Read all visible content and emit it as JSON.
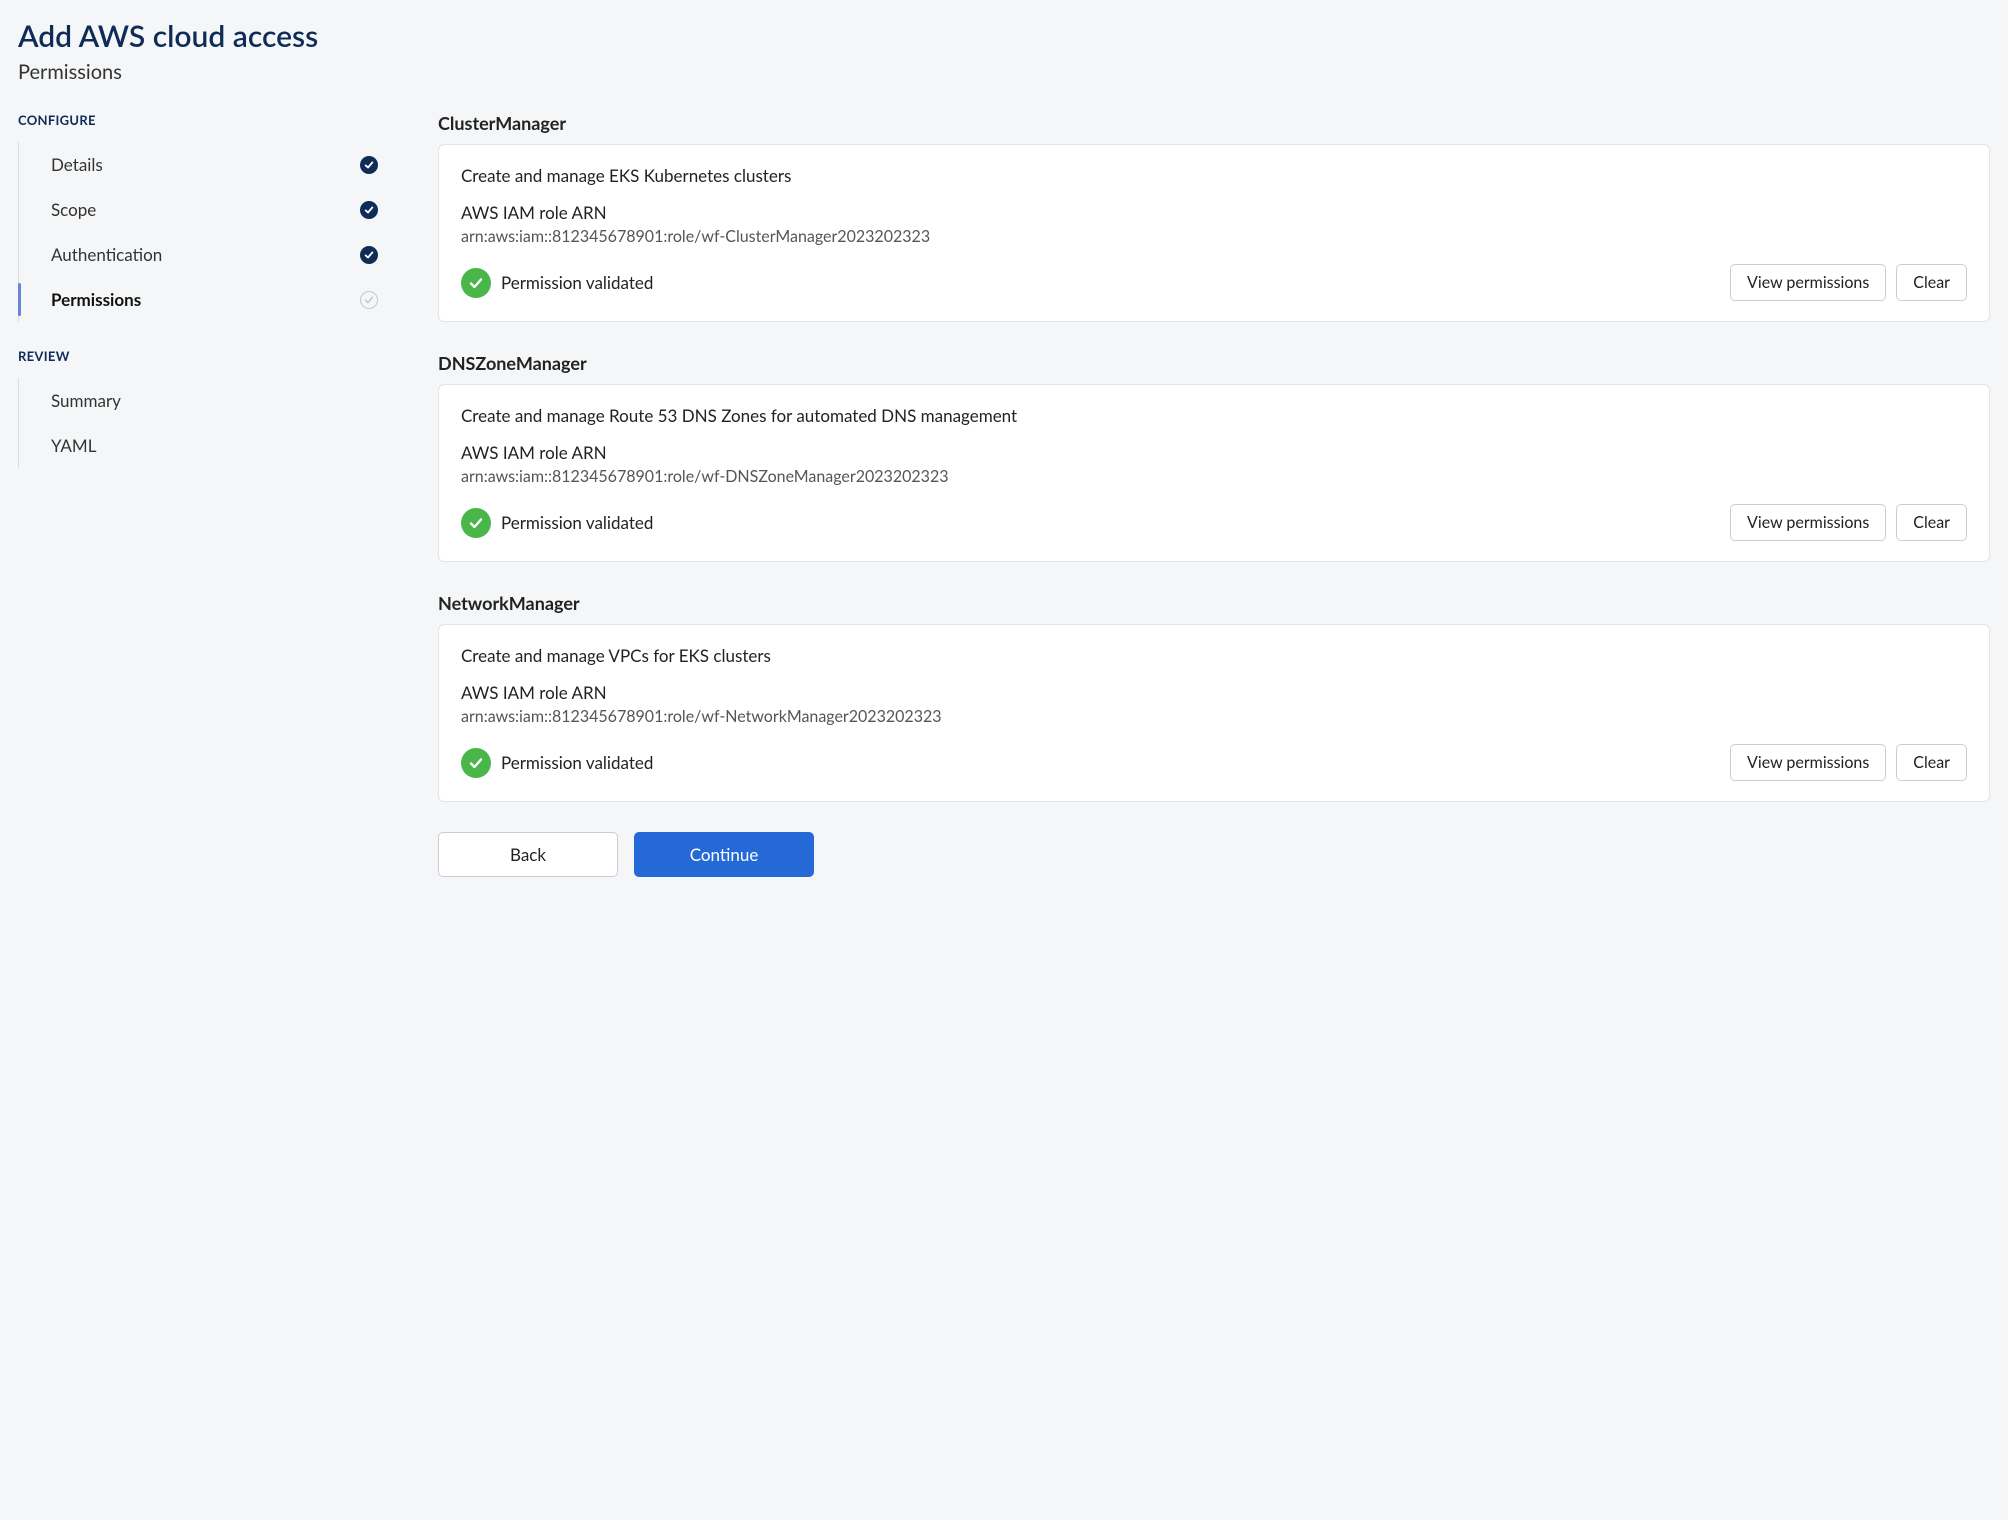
{
  "header": {
    "title": "Add AWS cloud access",
    "subtitle": "Permissions"
  },
  "sidebar": {
    "configure_label": "CONFIGURE",
    "review_label": "REVIEW",
    "configure_steps": [
      {
        "label": "Details",
        "status": "done"
      },
      {
        "label": "Scope",
        "status": "done"
      },
      {
        "label": "Authentication",
        "status": "done"
      },
      {
        "label": "Permissions",
        "status": "pending",
        "active": true
      }
    ],
    "review_steps": [
      {
        "label": "Summary"
      },
      {
        "label": "YAML"
      }
    ]
  },
  "labels": {
    "arn_label": "AWS IAM role ARN",
    "validated": "Permission validated",
    "view_permissions": "View permissions",
    "clear": "Clear",
    "back": "Back",
    "continue": "Continue"
  },
  "permissions": [
    {
      "name": "ClusterManager",
      "description": "Create and manage EKS Kubernetes clusters",
      "arn": "arn:aws:iam::812345678901:role/wf-ClusterManager2023202323"
    },
    {
      "name": "DNSZoneManager",
      "description": "Create and manage Route 53 DNS Zones for automated DNS management",
      "arn": "arn:aws:iam::812345678901:role/wf-DNSZoneManager2023202323"
    },
    {
      "name": "NetworkManager",
      "description": "Create and manage VPCs for EKS clusters",
      "arn": "arn:aws:iam::812345678901:role/wf-NetworkManager2023202323"
    }
  ]
}
